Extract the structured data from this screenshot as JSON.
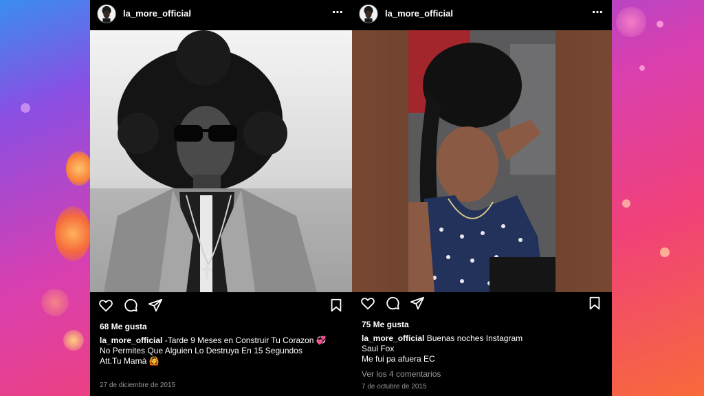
{
  "background": {
    "colors": [
      "#3a8df0",
      "#d83fb0",
      "#f86a3a"
    ]
  },
  "posts": [
    {
      "username": "la_more_official",
      "more_icon": "⋯",
      "likes": "68 Me gusta",
      "caption_user": "la_more_official",
      "caption_line1": "-Tarde 9 Meses en Construir Tu Corazon",
      "caption_emoji1": "💞",
      "caption_line2": "No Permites Que Alguien Lo Destruya En 15 Segundos",
      "caption_line3": "Att.Tu Mamà",
      "caption_emoji3": "🙆",
      "date": "27 de diciembre de 2015"
    },
    {
      "username": "la_more_official",
      "more_icon": "⋯",
      "likes": "75 Me gusta",
      "caption_user": "la_more_official",
      "caption_line1": "Buenas noches Instagram",
      "caption_line2": "Saul Fox",
      "caption_line3": "Me fui pa afuera EC",
      "comments": "Ver los 4 comentarios",
      "date": "7 de octubre de 2015"
    }
  ]
}
